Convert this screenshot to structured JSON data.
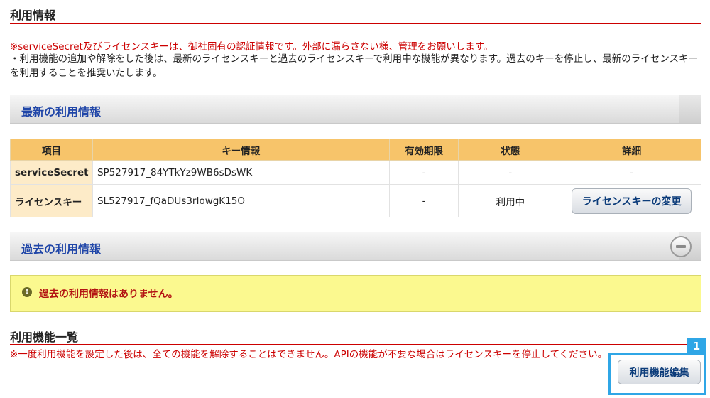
{
  "header": {
    "title": "利用情報",
    "warning": "※serviceSecret及びライセンスキーは、御社固有の認証情報です。外部に漏らさない様、管理をお願いします。",
    "note": "・利用機能の追加や解除をした後は、最新のライセンスキーと過去のライセンスキーで利用中な機能が異なります。過去のキーを停止し、最新のライセンスキーを利用することを推奨いたします。"
  },
  "latest": {
    "title": "最新の利用情報",
    "columns": [
      "項目",
      "キー情報",
      "有効期限",
      "状態",
      "詳細"
    ],
    "rows": [
      {
        "item": "serviceSecret",
        "key": "SP527917_84YTkYz9WB6sDsWK",
        "expiry": "-",
        "status": "-",
        "detail": "-"
      },
      {
        "item": "ライセンスキー",
        "key": "SL527917_fQaDUs3rIowgK15O",
        "expiry": "-",
        "status": "利用中",
        "detail_button": "ライセンスキーの変更"
      }
    ]
  },
  "past": {
    "title": "過去の利用情報",
    "alert": "過去の利用情報はありません。"
  },
  "features": {
    "title": "利用機能一覧",
    "warning": "※一度利用機能を設定した後は、全ての機能を解除することはできません。APIの機能が不要な場合はライセンスキーを停止してください。",
    "edit_button": "利用機能編集",
    "badge": "1"
  },
  "colors": {
    "accent_red": "#cc0000",
    "section_title_blue": "#2046a8",
    "table_header": "#f7c46a",
    "alert_bg": "#fbf98f",
    "highlight_blue": "#2fa6e6",
    "status_green": "#2e8b1f"
  }
}
